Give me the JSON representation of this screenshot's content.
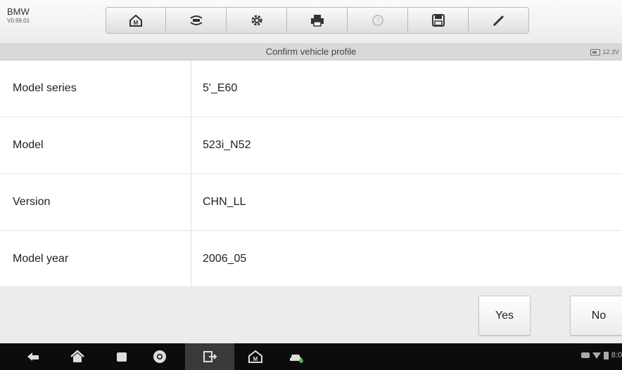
{
  "app": {
    "name": "BMW",
    "version": "V0.99.01"
  },
  "toolbar": {
    "buttons": [
      {
        "icon": "home-icon"
      },
      {
        "icon": "vehicle-swap-icon"
      },
      {
        "icon": "settings-icon"
      },
      {
        "icon": "print-icon"
      },
      {
        "icon": "help-icon"
      },
      {
        "icon": "save-icon"
      },
      {
        "icon": "edit-icon"
      }
    ]
  },
  "titlebar": {
    "title": "Confirm vehicle profile",
    "voltage": "12.3V"
  },
  "profile": {
    "rows": [
      {
        "label": "Model series",
        "value": "5'_E60"
      },
      {
        "label": "Model",
        "value": "523i_N52"
      },
      {
        "label": "Version",
        "value": "CHN_LL"
      },
      {
        "label": "Model year",
        "value": "2006_05"
      }
    ]
  },
  "actions": {
    "yes": "Yes",
    "no": "No"
  },
  "navbar": {
    "icons": [
      "back-icon",
      "home-icon",
      "recent-apps-icon",
      "browser-icon",
      "connect-icon",
      "app-home-icon",
      "vehicle-icon"
    ],
    "status_time": "8:0"
  },
  "colors": {
    "toolbar_icon": "#333333",
    "navbar_bg": "#0c0c0c",
    "disabled_icon": "#c0c0c0"
  }
}
